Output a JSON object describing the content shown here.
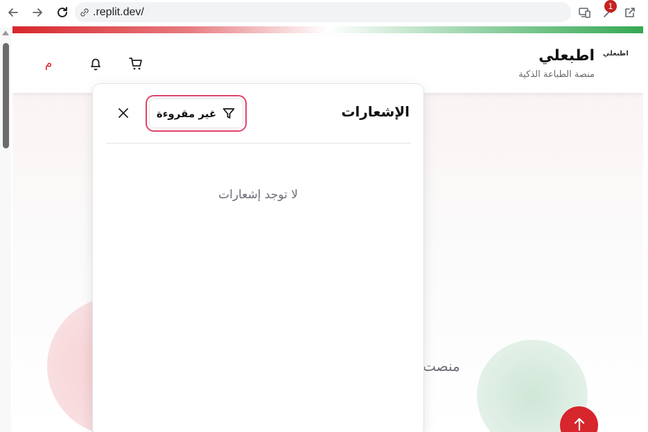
{
  "browser": {
    "url": ".replit.dev/",
    "extension_badge": "1"
  },
  "header": {
    "logo_text": "اطبعلي",
    "brand_name": "اطبعلي",
    "tagline": "منصة الطباعة الذكية",
    "avatar_initial": "م"
  },
  "notifications": {
    "title": "الإشعارات",
    "filter_label": "غير مقروءة",
    "empty_message": "لا توجد إشعارات"
  },
  "hero": {
    "partial_text": "منصت"
  },
  "colors": {
    "accent_red": "#d7262c",
    "accent_green": "#34a853",
    "focus_ring": "#e0436b"
  }
}
